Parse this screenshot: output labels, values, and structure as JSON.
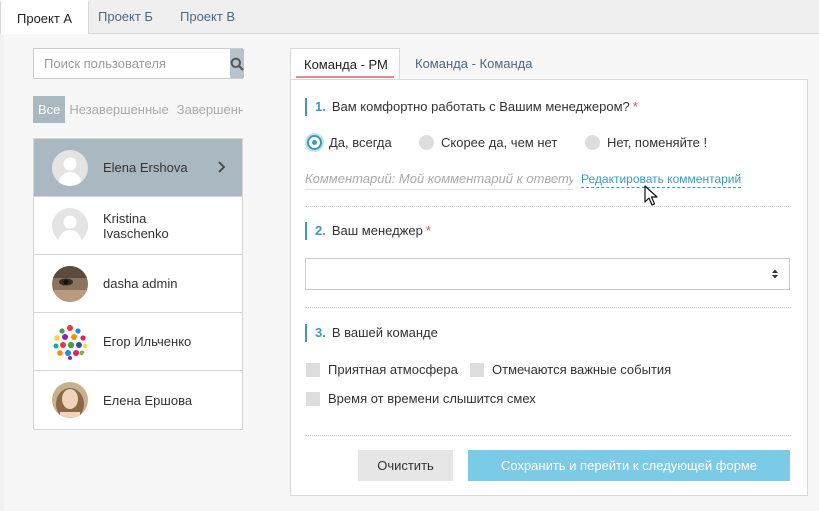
{
  "project_tabs": [
    {
      "label": "Проект А",
      "active": true
    },
    {
      "label": "Проект Б",
      "active": false
    },
    {
      "label": "Проект В",
      "active": false
    }
  ],
  "search": {
    "placeholder": "Поиск пользователя",
    "icon": "search-icon"
  },
  "filters": [
    {
      "label": "Все",
      "active": true
    },
    {
      "label": "Незавершенные",
      "active": false
    },
    {
      "label": "Завершенные",
      "active": false
    }
  ],
  "users": [
    {
      "name": "Elena Ershova",
      "avatar": "placeholder",
      "active": true
    },
    {
      "name": "Kristina Ivaschenko",
      "avatar": "placeholder",
      "active": false
    },
    {
      "name": "dasha admin",
      "avatar": "photo",
      "active": false
    },
    {
      "name": "Егор Ильченко",
      "avatar": "dots",
      "active": false
    },
    {
      "name": "Елена Ершова",
      "avatar": "photo",
      "active": false
    }
  ],
  "form_tabs": [
    {
      "label": "Команда - РМ",
      "active": true
    },
    {
      "label": "Команда - Команда",
      "active": false
    }
  ],
  "questions": {
    "q1": {
      "num": "1.",
      "text": "Вам комфортно работать с Вашим менеджером?",
      "required": "*",
      "options": [
        "Да, всегда",
        "Скорее да, чем нет",
        "Нет, поменяйте !"
      ],
      "selected": "Да, всегда",
      "comment_placeholder": "Комментарий: Мой комментарий к ответу",
      "edit_link": "Редактировать комментарий"
    },
    "q2": {
      "num": "2.",
      "text": "Ваш менеджер",
      "required": "*",
      "selected_value": ""
    },
    "q3": {
      "num": "3.",
      "text": "В вашей команде",
      "options": [
        "Приятная атмосфера",
        "Отмечаются важные события",
        "Время от времени слышится смех"
      ]
    }
  },
  "buttons": {
    "clear": "Очистить",
    "save": "Сохранить и перейти к следующей форме"
  },
  "colors": {
    "accent": "#3a9bbf",
    "active_bg": "#aab8c2",
    "save_button": "#7ccbe6",
    "required": "#d9534f",
    "tab_underline": "#e88a8a"
  }
}
